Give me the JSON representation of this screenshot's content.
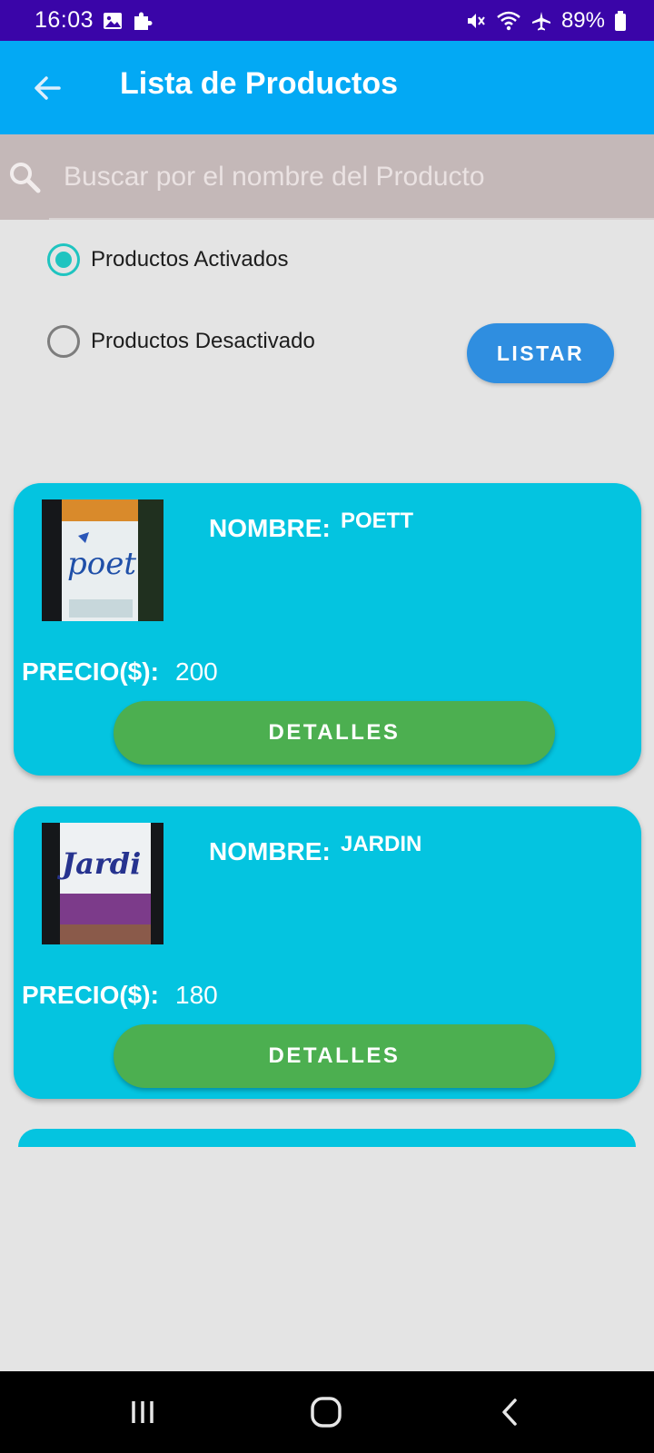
{
  "status_bar": {
    "time": "16:03",
    "battery": "89%",
    "icons": [
      "image-icon",
      "puzzle-icon",
      "mute-icon",
      "wifi-icon",
      "airplane-icon",
      "battery-icon"
    ]
  },
  "app_bar": {
    "title": "Lista de Productos",
    "back_icon": "arrow-back-icon"
  },
  "search": {
    "placeholder": "Buscar por el nombre del Producto",
    "value": ""
  },
  "filters": {
    "options": [
      {
        "label": "Productos Activados",
        "checked": true
      },
      {
        "label": "Productos Desactivado",
        "checked": false
      }
    ],
    "listar_label": "LISTAR"
  },
  "products": [
    {
      "name_label": "NOMBRE:",
      "name": "POETT",
      "price_label": "PRECIO($):",
      "price": "200",
      "details_label": "DETALLES"
    },
    {
      "name_label": "NOMBRE:",
      "name": "JARDIN",
      "price_label": "PRECIO($):",
      "price": "180",
      "details_label": "DETALLES"
    }
  ],
  "colors": {
    "status_bar": "#3a05a8",
    "app_bar": "#03a9f4",
    "card": "#04c4e0",
    "details_button": "#4caf50",
    "listar_button": "#2f8ee0",
    "radio_accent": "#1fc4c0"
  },
  "nav_bar": {
    "icons": [
      "recents-icon",
      "home-icon",
      "back-icon"
    ]
  }
}
